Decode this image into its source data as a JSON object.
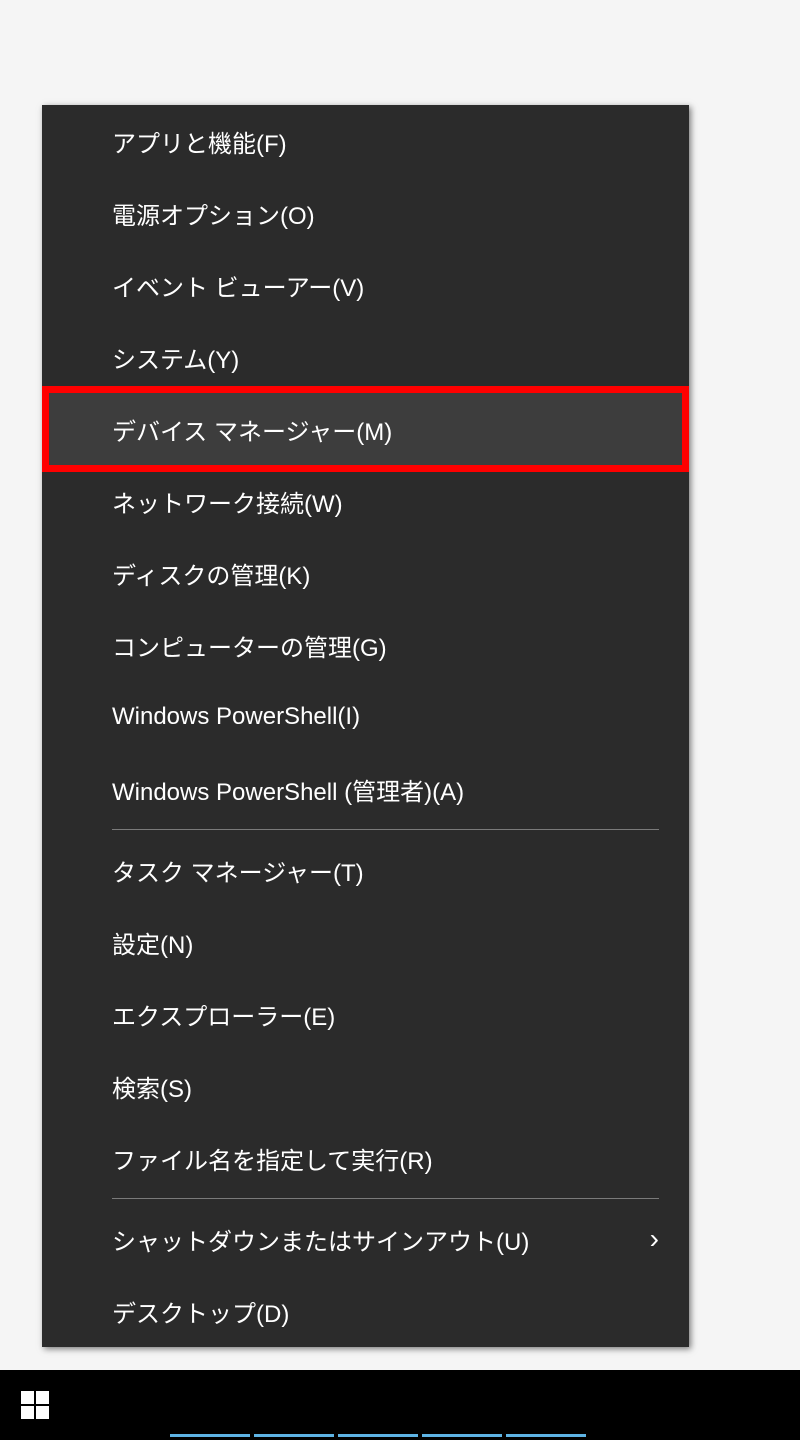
{
  "menu": {
    "groups": [
      {
        "items": [
          {
            "label": "アプリと機能(F)",
            "name": "menu-item-apps-features",
            "hasSubmenu": false,
            "highlighted": false
          },
          {
            "label": "電源オプション(O)",
            "name": "menu-item-power-options",
            "hasSubmenu": false,
            "highlighted": false
          },
          {
            "label": "イベント ビューアー(V)",
            "name": "menu-item-event-viewer",
            "hasSubmenu": false,
            "highlighted": false
          },
          {
            "label": "システム(Y)",
            "name": "menu-item-system",
            "hasSubmenu": false,
            "highlighted": false
          },
          {
            "label": "デバイス マネージャー(M)",
            "name": "menu-item-device-manager",
            "hasSubmenu": false,
            "highlighted": true
          },
          {
            "label": "ネットワーク接続(W)",
            "name": "menu-item-network-connections",
            "hasSubmenu": false,
            "highlighted": false
          },
          {
            "label": "ディスクの管理(K)",
            "name": "menu-item-disk-management",
            "hasSubmenu": false,
            "highlighted": false
          },
          {
            "label": "コンピューターの管理(G)",
            "name": "menu-item-computer-management",
            "hasSubmenu": false,
            "highlighted": false
          },
          {
            "label": "Windows PowerShell(I)",
            "name": "menu-item-powershell",
            "hasSubmenu": false,
            "highlighted": false
          },
          {
            "label": "Windows PowerShell (管理者)(A)",
            "name": "menu-item-powershell-admin",
            "hasSubmenu": false,
            "highlighted": false
          }
        ]
      },
      {
        "items": [
          {
            "label": "タスク マネージャー(T)",
            "name": "menu-item-task-manager",
            "hasSubmenu": false,
            "highlighted": false
          },
          {
            "label": "設定(N)",
            "name": "menu-item-settings",
            "hasSubmenu": false,
            "highlighted": false
          },
          {
            "label": "エクスプローラー(E)",
            "name": "menu-item-explorer",
            "hasSubmenu": false,
            "highlighted": false
          },
          {
            "label": "検索(S)",
            "name": "menu-item-search",
            "hasSubmenu": false,
            "highlighted": false
          },
          {
            "label": "ファイル名を指定して実行(R)",
            "name": "menu-item-run",
            "hasSubmenu": false,
            "highlighted": false
          }
        ]
      },
      {
        "items": [
          {
            "label": "シャットダウンまたはサインアウト(U)",
            "name": "menu-item-shutdown-signout",
            "hasSubmenu": true,
            "highlighted": false
          },
          {
            "label": "デスクトップ(D)",
            "name": "menu-item-desktop",
            "hasSubmenu": false,
            "highlighted": false
          }
        ]
      }
    ]
  }
}
